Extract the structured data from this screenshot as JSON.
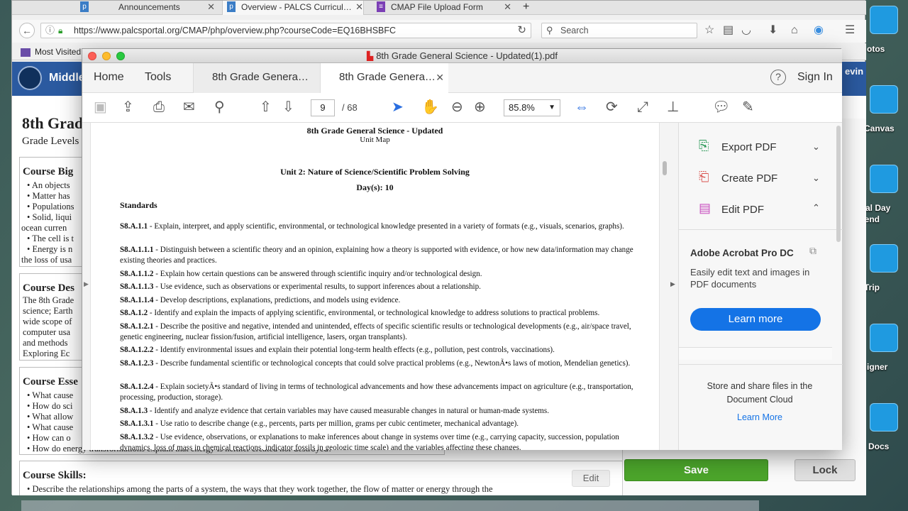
{
  "browser": {
    "tabs": [
      {
        "label": "Announcements"
      },
      {
        "label": "Overview - PALCS Curricul…"
      },
      {
        "label": "CMAP File Upload Form"
      }
    ],
    "url": "https://www.palcsportal.org/CMAP/php/overview.php?courseCode=EQ16BHSBFC",
    "search_placeholder": "Search",
    "bookmark": "Most Visited"
  },
  "desktop": {
    "labels": [
      "otos",
      "Canvas",
      "rial Day",
      "kend",
      "Trip",
      "igner",
      "Docs"
    ]
  },
  "site": {
    "header_title": "Middle",
    "user": "evin",
    "page_title": "8th Grad",
    "grade_levels": "Grade Levels",
    "big_ideas_heading": "Course Big",
    "big_ideas": [
      "An objects",
      "Matter has",
      "Populations",
      "Solid, liqui",
      "ocean curren",
      "The cell is t",
      "Energy is n",
      "the loss of usa"
    ],
    "description_heading": "Course Des",
    "description_lines": [
      "The 8th Grade",
      "science; Earth",
      "wide scope of",
      "computer usa",
      "and methods",
      "Exploring Ec"
    ],
    "essential_heading": "Course Esse",
    "essential": [
      "What cause",
      "How do sci",
      "What allow",
      "What cause",
      "How can o",
      "How do energy transformations explain that energy is neither created nor destroyed?"
    ],
    "skills_heading": "Course Skills:",
    "skills_first": "Describe the relationships among the parts of a system, the ways that they work together, the flow of matter or energy through the",
    "edit_label": "Edit",
    "save_label": "Save",
    "lock_label": "Lock"
  },
  "acrobat": {
    "window_title": "8th Grade General Science - Updated(1).pdf",
    "home_tab": "Home",
    "tools_tab": "Tools",
    "doc_tab_1": "8th Grade Genera…",
    "doc_tab_2": "8th Grade Genera…",
    "sign_in": "Sign In",
    "page_current": "9",
    "page_total": "/ 68",
    "zoom": "85.8%",
    "right_panel": {
      "export": "Export PDF",
      "create": "Create PDF",
      "edit": "Edit PDF",
      "promo_title": "Adobe Acrobat Pro DC",
      "promo_text": "Easily edit text and images in PDF documents",
      "learn_more_btn": "Learn more",
      "cloud_text": "Store and share files in the Document Cloud",
      "cloud_link": "Learn More"
    }
  },
  "pdf": {
    "doc_title": "8th Grade General Science - Updated",
    "doc_subtitle": "Unit Map",
    "unit": "Unit 2: Nature of Science/Scientific Problem Solving",
    "days": "Day(s): 10",
    "standards_heading": "Standards",
    "standards": [
      {
        "code": "S8.A.1.1",
        "text": " - Explain, interpret, and apply scientific, environmental, or technological knowledge presented in a variety of formats (e.g., visuals, scenarios, graphs)."
      },
      {
        "code": "S8.A.1.1.1",
        "text": " - Distinguish between a scientific theory and an opinion, explaining how a theory is supported with evidence, or how new data/information may change existing theories and practices."
      },
      {
        "code": "S8.A.1.1.2",
        "text": " - Explain how certain questions can be answered through scientific inquiry and/or technological design."
      },
      {
        "code": "S8.A.1.1.3",
        "text": " - Use evidence, such as observations or experimental results, to support inferences about a relationship."
      },
      {
        "code": "S8.A.1.1.4",
        "text": " - Develop descriptions, explanations, predictions, and models using evidence."
      },
      {
        "code": "S8.A.1.2",
        "text": " - Identify and explain the impacts of applying scientific, environmental, or technological knowledge to address solutions to practical problems."
      },
      {
        "code": "S8.A.1.2.1",
        "text": " - Describe the positive and negative, intended and unintended, effects of specific scientific results or technological developments (e.g., air/space travel, genetic engineering, nuclear fission/fusion, artificial intelligence, lasers, organ transplants)."
      },
      {
        "code": "S8.A.1.2.2",
        "text": " - Identify environmental issues and explain their potential long-term health effects (e.g., pollution, pest controls, vaccinations)."
      },
      {
        "code": "S8.A.1.2.3",
        "text": " - Describe fundamental scientific or technological concepts that could solve practical problems (e.g., NewtonÃ•s laws of motion, Mendelian genetics)."
      },
      {
        "code": "S8.A.1.2.4",
        "text": " - Explain societyÃ•s standard of living in terms of technological advancements and how these advancements impact on agriculture (e.g., transportation, processing, production, storage)."
      },
      {
        "code": "S8.A.1.3",
        "text": " - Identify and analyze evidence that certain variables may have caused measurable changes in natural or human-made systems."
      },
      {
        "code": "S8.A.1.3.1",
        "text": " - Use ratio to describe change (e.g., percents, parts per million, grams per cubic centimeter, mechanical advantage)."
      },
      {
        "code": "S8.A.1.3.2",
        "text": " - Use evidence, observations, or explanations to make inferences about change in systems over time (e.g., carrying capacity, succession, population dynamics, loss of mass in chemical reactions, indicator fossils in geologic time scale) and the variables affecting these changes."
      }
    ]
  }
}
